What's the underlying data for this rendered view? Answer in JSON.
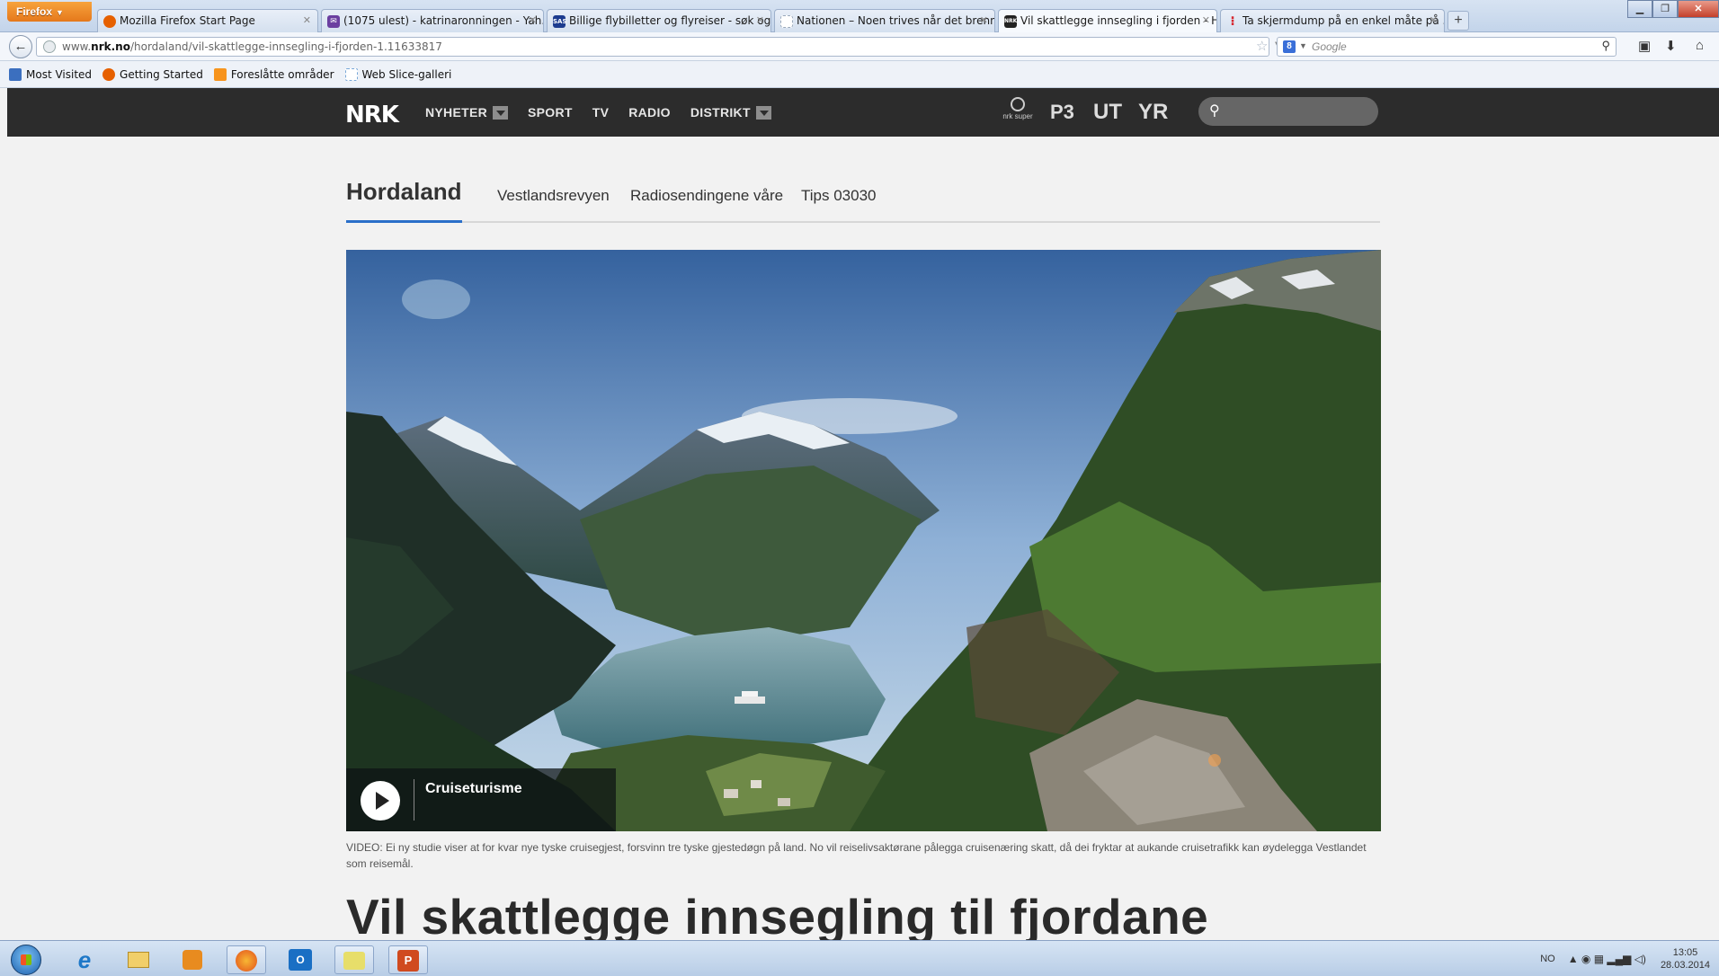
{
  "browser": {
    "menu_label": "Firefox",
    "tabs": [
      {
        "title": "Mozilla Firefox Start Page",
        "icon": "firefox-icon",
        "color": "#e66000"
      },
      {
        "title": "(1075 ulest) - katrinaronningen - Yah...",
        "icon": "mail-icon",
        "color": "#6b3fa0"
      },
      {
        "title": "Billige flybilletter og flyreiser - søk og ...",
        "icon": "sas-icon",
        "color": "#1d3c8f"
      },
      {
        "title": "Nationen – Noen trives når det brenn...",
        "icon": "page-icon",
        "color": "#9aa9bb"
      },
      {
        "title": "Vil skattlegge innsegling i fjorden - H...",
        "icon": "nrk-icon",
        "color": "#222222"
      },
      {
        "title": "Ta skjermdump på en enkel måte på ...",
        "icon": "bullet-icon",
        "color": "#d6262e"
      }
    ],
    "url": {
      "prefix": "www.",
      "domain": "nrk.no",
      "path": "/hordaland/vil-skattlegge-innsegling-i-fjorden-1.11633817"
    },
    "search_placeholder": "Google",
    "bookmarks": [
      {
        "label": "Most Visited",
        "color": "#3b6fbf"
      },
      {
        "label": "Getting Started",
        "color": "#e66000"
      },
      {
        "label": "Foreslåtte områder",
        "color": "#f7941d"
      },
      {
        "label": "Web Slice-galleri",
        "color": "#7aa8d8"
      }
    ]
  },
  "nrk": {
    "logo": "NRK",
    "nav": [
      "NYHETER",
      "SPORT",
      "TV",
      "RADIO",
      "DISTRIKT"
    ],
    "super_label": "nrk super",
    "p3_label": "P3",
    "ut_label": "UT",
    "yr_label": "YR"
  },
  "page": {
    "region": "Hordaland",
    "sub_links": [
      "Vestlandsrevyen",
      "Radiosendingene våre",
      "Tips 03030"
    ],
    "video_title": "Cruiseturisme",
    "caption": "VIDEO: Ei ny studie viser at for kvar nye tyske cruisegjest, forsvinn tre tyske gjestedøgn på land. No vil reiselivsaktørane pålegga cruisenæring skatt, då dei fryktar at aukande cruisetrafikk kan øydelegga Vestlandet som reisemål.",
    "headline": "Vil skattlegge innsegling til fjordane"
  },
  "taskbar": {
    "language": "NO",
    "time": "13:05",
    "date": "28.03.2014"
  }
}
